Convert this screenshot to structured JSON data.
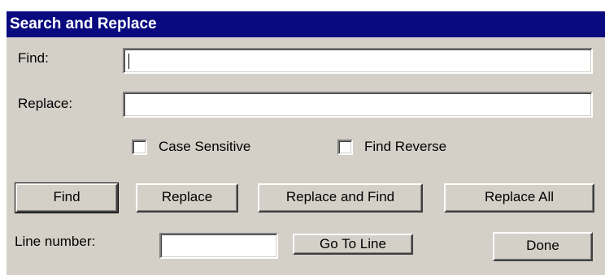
{
  "dialog": {
    "title": "Search and Replace"
  },
  "find": {
    "label": "Find:",
    "value": ""
  },
  "replace": {
    "label": "Replace:",
    "value": ""
  },
  "options": {
    "case_sensitive_label": "Case Sensitive",
    "case_sensitive_checked": false,
    "find_reverse_label": "Find Reverse",
    "find_reverse_checked": false
  },
  "buttons": {
    "find": "Find",
    "replace": "Replace",
    "replace_and_find": "Replace and Find",
    "replace_all": "Replace All",
    "go_to_line": "Go To Line",
    "done": "Done"
  },
  "line_number": {
    "label": "Line number:",
    "value": ""
  },
  "colors": {
    "titlebar": "#0a0a80",
    "dialog_bg": "#d4d0c8"
  }
}
